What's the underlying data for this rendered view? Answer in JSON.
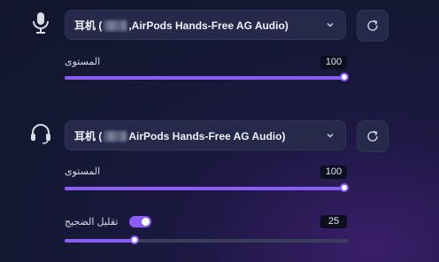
{
  "microphone": {
    "icon": "microphone-icon",
    "device_prefix": "耳机 (",
    "device_suffix": ",AirPods Hands-Free AG Audio)",
    "level_label": "المستوى",
    "level_value": "100",
    "level_fraction": 1.0
  },
  "headphones": {
    "icon": "headphones-icon",
    "device_prefix": "耳机 (",
    "device_suffix": "AirPods Hands-Free AG Audio)",
    "level_label": "المستوى",
    "level_value": "100",
    "level_fraction": 1.0,
    "noise_label": "تقليل الضجيج",
    "noise_enabled": true,
    "noise_value": "25",
    "noise_fraction": 0.25
  },
  "colors": {
    "accent": "#8b5cf6",
    "panel": "#26294a"
  }
}
